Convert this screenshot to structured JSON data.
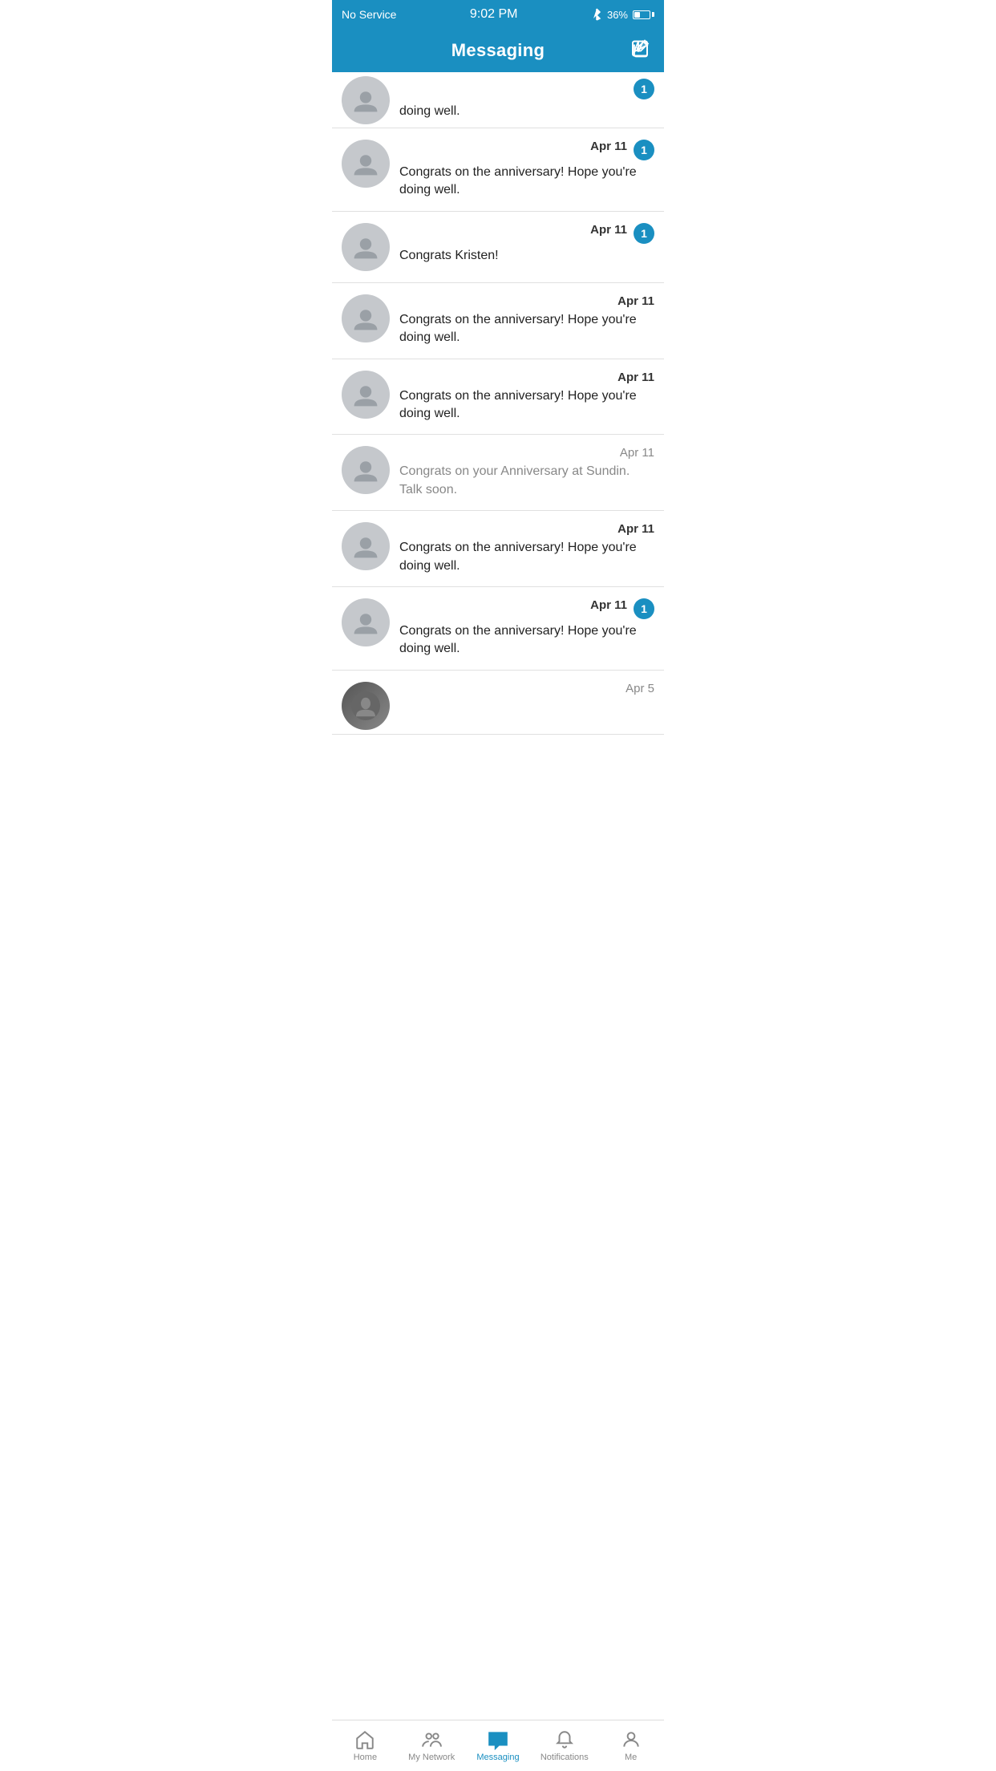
{
  "statusBar": {
    "signal": "No Service",
    "time": "9:02 PM",
    "battery": "36%"
  },
  "header": {
    "title": "Messaging",
    "composeLabel": "Compose"
  },
  "messages": [
    {
      "id": 1,
      "avatarType": "default",
      "text": "doing well.",
      "date": "",
      "unread": true,
      "badge": 1,
      "partial": true
    },
    {
      "id": 2,
      "avatarType": "default",
      "text": "Congrats on the anniversary! Hope you're doing well.",
      "date": "Apr 11",
      "unread": true,
      "badge": 1,
      "partial": false
    },
    {
      "id": 3,
      "avatarType": "default",
      "text": "Congrats Kristen!",
      "date": "Apr 11",
      "unread": true,
      "badge": 1,
      "partial": false
    },
    {
      "id": 4,
      "avatarType": "default",
      "text": "Congrats on the anniversary! Hope you're doing well.",
      "date": "Apr 11",
      "unread": true,
      "badge": 0,
      "partial": false
    },
    {
      "id": 5,
      "avatarType": "default",
      "text": "Congrats on the anniversary! Hope you're doing well.",
      "date": "Apr 11",
      "unread": true,
      "badge": 0,
      "partial": false
    },
    {
      "id": 6,
      "avatarType": "default",
      "text": "Congrats on your Anniversary at Sundin. Talk soon.",
      "date": "Apr 11",
      "unread": false,
      "badge": 0,
      "partial": false
    },
    {
      "id": 7,
      "avatarType": "default",
      "text": "Congrats on the anniversary! Hope you're doing well.",
      "date": "Apr 11",
      "unread": true,
      "badge": 0,
      "partial": false
    },
    {
      "id": 8,
      "avatarType": "default",
      "text": "Congrats on the anniversary! Hope you're doing well.",
      "date": "Apr 11",
      "unread": true,
      "badge": 1,
      "partial": false
    },
    {
      "id": 9,
      "avatarType": "photo",
      "text": "",
      "date": "Apr 5",
      "unread": false,
      "badge": 0,
      "partial": true
    }
  ],
  "bottomNav": {
    "items": [
      {
        "id": "home",
        "label": "Home",
        "active": false
      },
      {
        "id": "my-network",
        "label": "My Network",
        "active": false
      },
      {
        "id": "messaging",
        "label": "Messaging",
        "active": true
      },
      {
        "id": "notifications",
        "label": "Notifications",
        "active": false
      },
      {
        "id": "me",
        "label": "Me",
        "active": false
      }
    ]
  }
}
